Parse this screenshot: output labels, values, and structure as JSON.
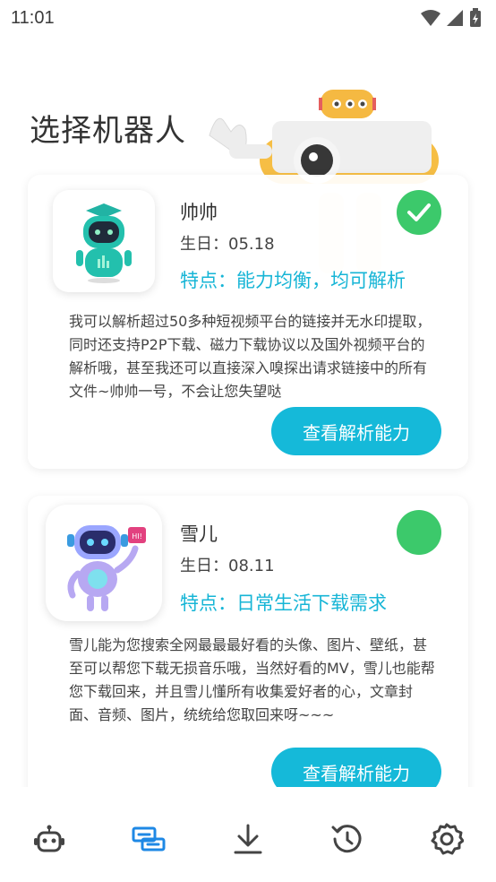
{
  "status_bar": {
    "time": "11:01"
  },
  "page_title": "选择机器人",
  "robots": [
    {
      "name": "帅帅",
      "birthday": "生日：05.18",
      "feature": "特点：能力均衡，均可解析",
      "description": "我可以解析超过50多种短视频平台的链接并无水印提取，同时还支持P2P下载、磁力下载协议以及国外视频平台的解析哦，甚至我还可以直接深入嗅探出请求链接中的所有文件~帅帅一号，不会让您失望哒",
      "button_label": "查看解析能力",
      "selected": true
    },
    {
      "name": "雪儿",
      "birthday": "生日：08.11",
      "feature": "特点：日常生活下载需求",
      "description": "雪儿能为您搜索全网最最最好看的头像、图片、壁纸，甚至可以帮您下载无损音乐哦，当然好看的MV，雪儿也能帮您下载回来，并且雪儿懂所有收集爱好者的心，文章封面、音频、图片，统统给您取回来呀~~~",
      "button_label": "查看解析能力",
      "selected": false,
      "badge_text": "HI!"
    }
  ],
  "bottom_nav": [
    {
      "icon": "robot-icon",
      "active": false
    },
    {
      "icon": "link-parse-icon",
      "active": true
    },
    {
      "icon": "download-icon",
      "active": false
    },
    {
      "icon": "history-icon",
      "active": false
    },
    {
      "icon": "settings-icon",
      "active": false
    }
  ],
  "colors": {
    "accent": "#15b9d9",
    "selected": "#3cc96b",
    "nav_active": "#1e88e5",
    "nav_inactive": "#444444"
  }
}
